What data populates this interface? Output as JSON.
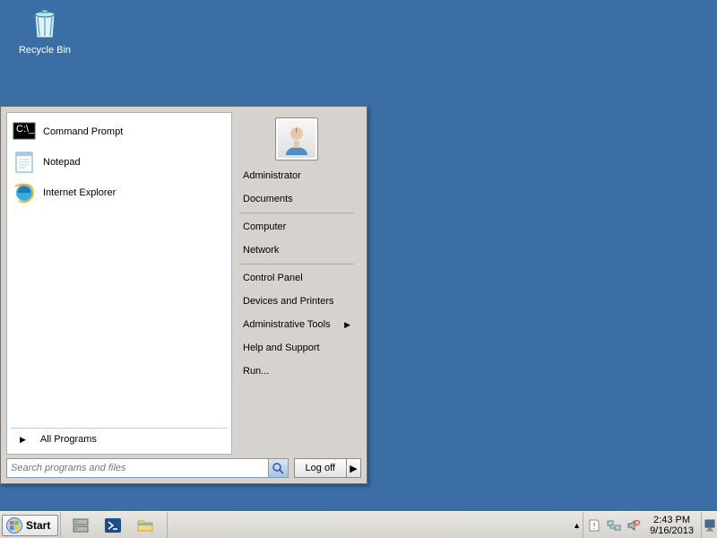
{
  "desktop": {
    "recycle_bin": "Recycle Bin"
  },
  "start_menu": {
    "programs": [
      {
        "label": "Command Prompt",
        "icon": "cmd"
      },
      {
        "label": "Notepad",
        "icon": "notepad"
      },
      {
        "label": "Internet Explorer",
        "icon": "ie"
      }
    ],
    "all_programs": "All Programs",
    "right": {
      "items": [
        {
          "label": "Administrator",
          "sep_after": false
        },
        {
          "label": "Documents",
          "sep_after": true
        },
        {
          "label": "Computer",
          "sep_after": false
        },
        {
          "label": "Network",
          "sep_after": true
        },
        {
          "label": "Control Panel",
          "sep_after": false
        },
        {
          "label": "Devices and Printers",
          "sep_after": false
        },
        {
          "label": "Administrative Tools",
          "submenu": true,
          "sep_after": false
        },
        {
          "label": "Help and Support",
          "sep_after": false
        },
        {
          "label": "Run...",
          "sep_after": false
        }
      ]
    },
    "search_placeholder": "Search programs and files",
    "logoff": "Log off"
  },
  "taskbar": {
    "start": "Start",
    "clock_time": "2:43 PM",
    "clock_date": "9/16/2013"
  }
}
